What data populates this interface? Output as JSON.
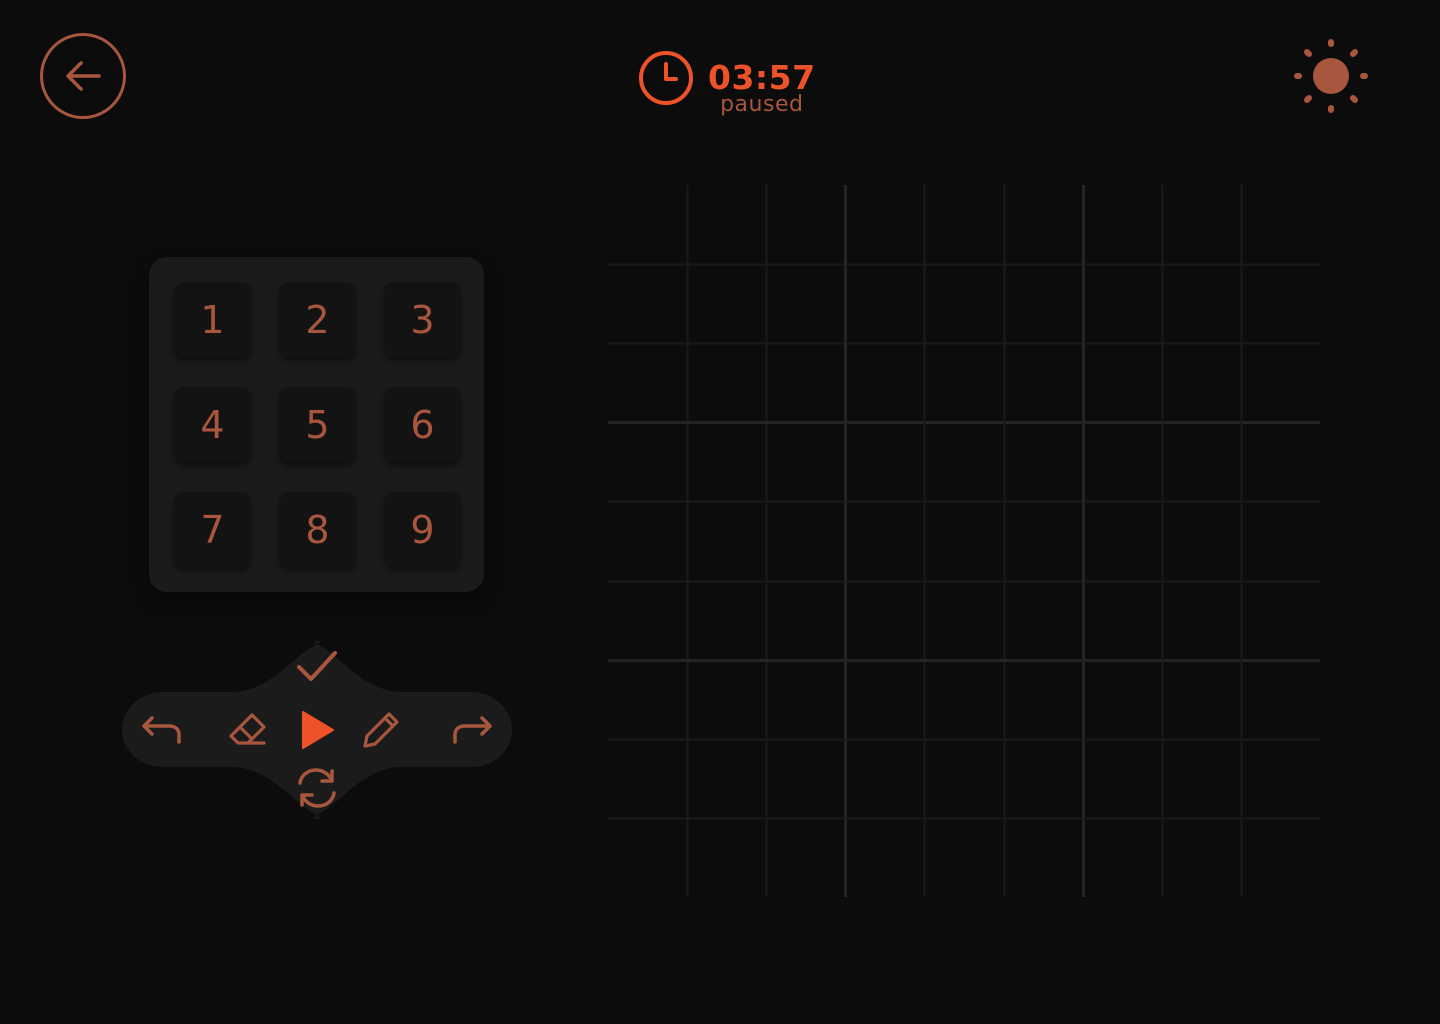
{
  "header": {
    "back_icon": "arrow-left-icon",
    "timer": {
      "icon": "clock-icon",
      "time": "03:57",
      "status": "paused"
    },
    "theme_icon": "sun-icon"
  },
  "numpad": {
    "keys": [
      "1",
      "2",
      "3",
      "4",
      "5",
      "6",
      "7",
      "8",
      "9"
    ]
  },
  "controls": {
    "undo_icon": "undo-icon",
    "erase_icon": "eraser-icon",
    "play_icon": "play-icon",
    "pencil_icon": "pencil-icon",
    "redo_icon": "redo-icon",
    "check_icon": "check-icon",
    "restart_icon": "restart-icon"
  },
  "board": {
    "size": 9,
    "cells": [
      [
        "",
        "",
        "",
        "",
        "",
        "",
        "",
        "",
        ""
      ],
      [
        "",
        "",
        "",
        "",
        "",
        "",
        "",
        "",
        ""
      ],
      [
        "",
        "",
        "",
        "",
        "",
        "",
        "",
        "",
        ""
      ],
      [
        "",
        "",
        "",
        "",
        "",
        "",
        "",
        "",
        ""
      ],
      [
        "",
        "",
        "",
        "",
        "",
        "",
        "",
        "",
        ""
      ],
      [
        "",
        "",
        "",
        "",
        "",
        "",
        "",
        "",
        ""
      ],
      [
        "",
        "",
        "",
        "",
        "",
        "",
        "",
        "",
        ""
      ],
      [
        "",
        "",
        "",
        "",
        "",
        "",
        "",
        "",
        ""
      ],
      [
        "",
        "",
        "",
        "",
        "",
        "",
        "",
        "",
        ""
      ]
    ]
  },
  "colors": {
    "background": "#0c0c0c",
    "accent": "#ee5228",
    "muted_accent": "#a8563d",
    "panel": "#1b1b1b",
    "key": "#131313"
  }
}
